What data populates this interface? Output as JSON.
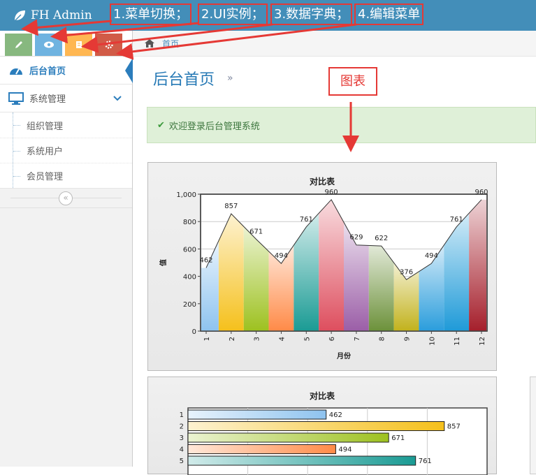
{
  "header": {
    "brand": "FH Admin",
    "annotations": [
      "1.菜单切换；",
      "2.UI实例；",
      "3.数据字典；",
      "4.编辑菜单"
    ],
    "bg_color": "#438eb9"
  },
  "shortcuts": [
    {
      "icon": "pencil-icon",
      "color": "#87b87f"
    },
    {
      "icon": "eye-icon",
      "color": "#6fb3e0"
    },
    {
      "icon": "book-icon",
      "color": "#ffb752"
    },
    {
      "icon": "cog-icon",
      "color": "#d15b47"
    }
  ],
  "sidebar": {
    "items": [
      {
        "label": "后台首页",
        "icon": "dashboard-icon",
        "active": true
      },
      {
        "label": "系统管理",
        "icon": "desktop-icon",
        "active": false
      }
    ],
    "submenu": [
      "组织管理",
      "系统用户",
      "会员管理"
    ],
    "collapse_icon": "double-chevron-left-icon"
  },
  "breadcrumb": {
    "home_label": "首页"
  },
  "main": {
    "title": "后台首页",
    "title_sep": "»",
    "alert": "欢迎登录后台管理系统",
    "chart_annotation": "图表"
  },
  "chart_data": [
    {
      "type": "area",
      "title": "对比表",
      "xlabel": "月份",
      "ylabel": "值",
      "categories": [
        "1",
        "2",
        "3",
        "4",
        "5",
        "6",
        "7",
        "8",
        "9",
        "10",
        "11",
        "12"
      ],
      "values": [
        462,
        857,
        671,
        494,
        761,
        960,
        629,
        622,
        376,
        494,
        761,
        960
      ],
      "ylim": [
        0,
        1000
      ],
      "yticks": [
        "0",
        "200",
        "400",
        "600",
        "800",
        "1,000"
      ],
      "colors": [
        "#8ec3ef",
        "#f5c01b",
        "#9dc11f",
        "#ff8a47",
        "#1a9b94",
        "#de4e5e",
        "#9b5ea7",
        "#6c913a",
        "#c2b21c",
        "#2a9ddc",
        "#1e9ad8",
        "#a51f2b"
      ]
    },
    {
      "type": "bar",
      "title": "对比表",
      "categories": [
        "1",
        "2",
        "3",
        "4",
        "5"
      ],
      "values": [
        462,
        857,
        671,
        494,
        761
      ],
      "xlim": [
        0,
        1000
      ],
      "colors": [
        "#8ec3ef",
        "#f5c01b",
        "#9dc11f",
        "#ff8a47",
        "#1a9b94"
      ]
    }
  ]
}
